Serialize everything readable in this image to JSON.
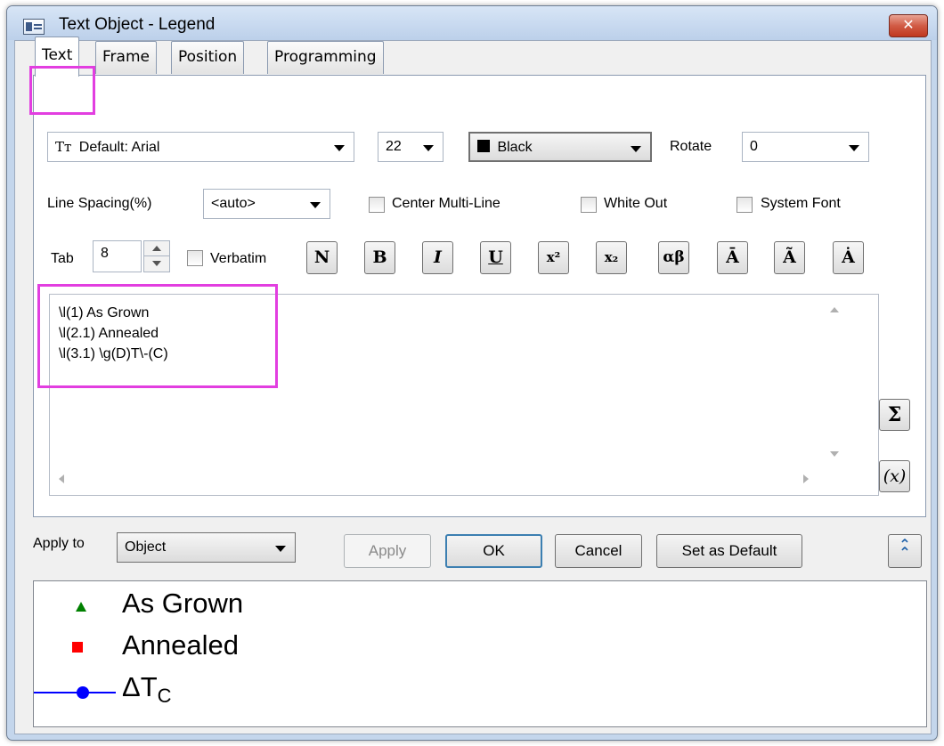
{
  "window": {
    "title": "Text Object - Legend",
    "close_glyph": "✕"
  },
  "tabs": [
    "Text",
    "Frame",
    "Position",
    "Programming"
  ],
  "text_tab": {
    "font": "Default: Arial",
    "font_icon": "Tт",
    "size": "22",
    "color": "Black",
    "color_value": "#000000",
    "rotate_label": "Rotate",
    "rotate_value": "0",
    "line_spacing_label": "Line Spacing(%)",
    "line_spacing_value": "<auto>",
    "center_multiline_label": "Center Multi-Line",
    "white_out_label": "White Out",
    "system_font_label": "System Font",
    "tab_label": "Tab",
    "tab_value": "8",
    "verbatim_label": "Verbatim",
    "format_buttons": [
      "N",
      "B",
      "I",
      "U",
      "x²",
      "x₂",
      "αβ",
      "Ā",
      "Ã",
      "Ȧ"
    ],
    "editor_lines": [
      "\\l(1) As Grown",
      "\\l(2.1) Annealed",
      "\\l(3.1) \\g(D)T\\-(C)"
    ],
    "sigma_button": "Σ",
    "variable_button": "(x)"
  },
  "bottom": {
    "apply_to_label": "Apply to",
    "apply_to_value": "Object",
    "apply_button": "Apply",
    "ok_button": "OK",
    "cancel_button": "Cancel",
    "set_default_button": "Set as Default",
    "collapse_glyph": "⌃"
  },
  "preview": {
    "items": [
      {
        "label": "As Grown",
        "symbol": "triangle",
        "color": "#008000"
      },
      {
        "label": "Annealed",
        "symbol": "square",
        "color": "#ff0000"
      },
      {
        "label": "ΔT",
        "subscript": "C",
        "symbol": "line-circle",
        "color": "#0000ff"
      }
    ]
  },
  "colors": {
    "highlight": "#e23ee0",
    "accent": "#3c7fb1"
  }
}
